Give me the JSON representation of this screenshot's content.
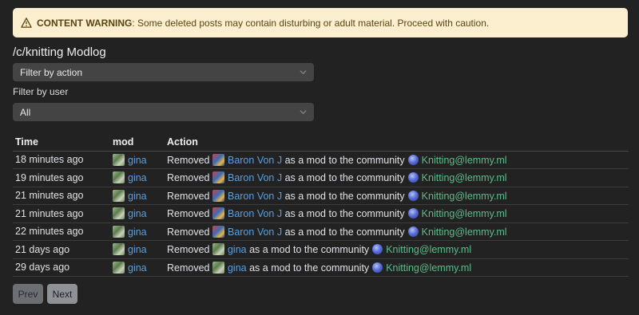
{
  "warning": {
    "label": "CONTENT WARNING",
    "text": ": Some deleted posts may contain disturbing or adult material. Proceed with caution."
  },
  "page_title": "/c/knitting Modlog",
  "filter_action": {
    "value": "Filter by action"
  },
  "filter_user": {
    "label": "Filter by user",
    "value": "All"
  },
  "table": {
    "headers": {
      "time": "Time",
      "mod": "mod",
      "action": "Action"
    },
    "rows": [
      {
        "time": "18 minutes ago",
        "mod": "gina",
        "verb": "Removed",
        "target": "Baron Von J",
        "phrase": "as a mod to the community",
        "community": "Knitting@lemmy.ml"
      },
      {
        "time": "19 minutes ago",
        "mod": "gina",
        "verb": "Removed",
        "target": "Baron Von J",
        "phrase": "as a mod to the community",
        "community": "Knitting@lemmy.ml"
      },
      {
        "time": "21 minutes ago",
        "mod": "gina",
        "verb": "Removed",
        "target": "Baron Von J",
        "phrase": "as a mod to the community",
        "community": "Knitting@lemmy.ml"
      },
      {
        "time": "21 minutes ago",
        "mod": "gina",
        "verb": "Removed",
        "target": "Baron Von J",
        "phrase": "as a mod to the community",
        "community": "Knitting@lemmy.ml"
      },
      {
        "time": "22 minutes ago",
        "mod": "gina",
        "verb": "Removed",
        "target": "Baron Von J",
        "phrase": "as a mod to the community",
        "community": "Knitting@lemmy.ml"
      },
      {
        "time": "21 days ago",
        "mod": "gina",
        "verb": "Removed",
        "target": "gina",
        "phrase": "as a mod to the community",
        "community": "Knitting@lemmy.ml"
      },
      {
        "time": "29 days ago",
        "mod": "gina",
        "verb": "Removed",
        "target": "gina",
        "phrase": "as a mod to the community",
        "community": "Knitting@lemmy.ml"
      }
    ]
  },
  "pagination": {
    "prev": "Prev",
    "next": "Next"
  },
  "icons": {
    "warning": "warning-triangle-icon",
    "chevron": "chevron-down-icon",
    "community": "community-globe-icon"
  },
  "colors": {
    "background": "#222222",
    "warning_bg": "#fcefcf",
    "link_blue": "#5a9fe0",
    "link_green": "#5cbd8a"
  }
}
